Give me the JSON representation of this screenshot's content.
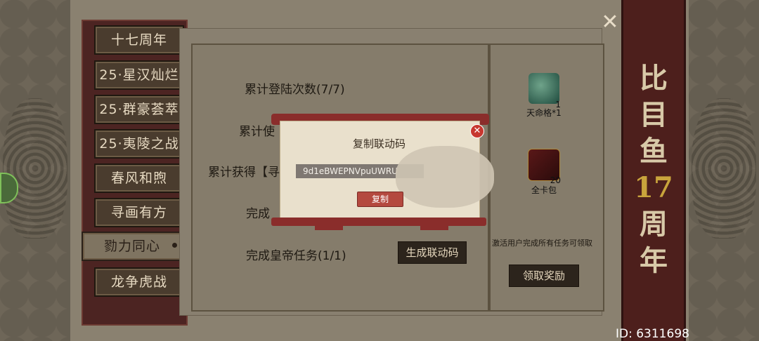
{
  "event_banner": {
    "line1": "比",
    "line2": "目",
    "line3": "鱼",
    "number": "17",
    "line4": "周",
    "line5": "年"
  },
  "tabs": [
    {
      "label": "十七周年"
    },
    {
      "label": "25·星汉灿烂"
    },
    {
      "label": "25·群豪荟萃"
    },
    {
      "label": "25·夷陵之战"
    },
    {
      "label": "春风和煦"
    },
    {
      "label": "寻画有方"
    },
    {
      "label": "勠力同心"
    },
    {
      "label": "龙争虎战"
    }
  ],
  "active_tab": "勠力同心",
  "tasks": [
    {
      "label": "累计登陆次数(7/7)"
    },
    {
      "label": "累计使"
    },
    {
      "label": "累计获得【寻"
    },
    {
      "label": "完成"
    },
    {
      "label": "完成皇帝任务(1/1)"
    }
  ],
  "generate_button": "生成联动码",
  "rewards": [
    {
      "name": "天命格*1",
      "count": "1",
      "icon": "jade-seal-icon"
    },
    {
      "name": "全卡包",
      "count": "20",
      "icon": "card-pack-icon"
    }
  ],
  "reward_note": "激活用户完成所有任务可领取",
  "claim_button": "领取奖励",
  "modal": {
    "title": "复制联动码",
    "code": "9d1eBWEPNVpuUWRU",
    "copy_button": "复制",
    "close_icon": "close-icon"
  },
  "close_glyph": "✕",
  "player_id": "ID: 6311698",
  "colors": {
    "banner_red": "#4d1f1c",
    "accent_gold": "#c9a43c",
    "modal_red": "#8a2d2b"
  }
}
